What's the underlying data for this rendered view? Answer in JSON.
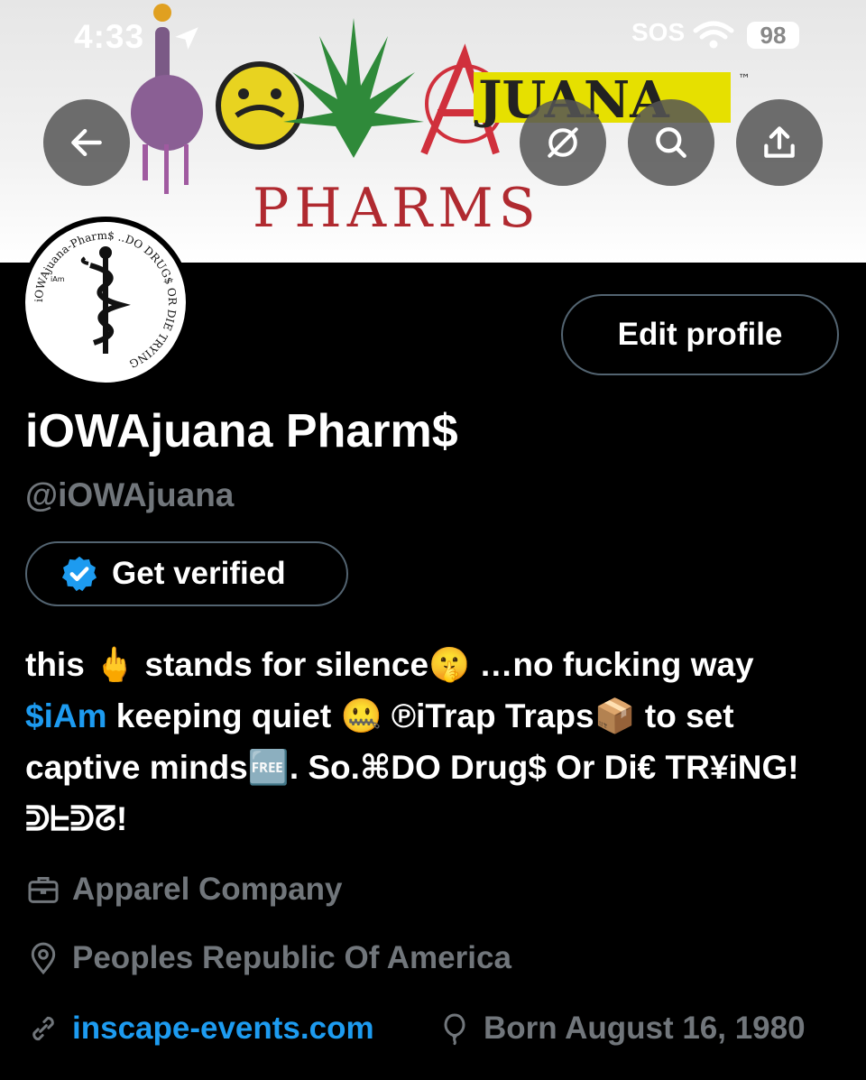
{
  "status_bar": {
    "time": "4:33",
    "carrier": "SOS",
    "battery": "98"
  },
  "banner": {
    "logo_text": "JUANA",
    "logo_tm": "™",
    "logo_subtitle": "PHARMS"
  },
  "avatar": {
    "ring_text": "iOWAjuana-Pharm$ ..DO DRUG$ OR DIE TRYING",
    "small_text": "iAm"
  },
  "header_buttons": {
    "back": "back-arrow",
    "grok": "slash-circle",
    "search": "search",
    "share": "share"
  },
  "profile": {
    "edit_label": "Edit profile",
    "display_name": "iOWAjuana Pharm$",
    "handle": "@iOWAjuana",
    "verified_label": "Get verified",
    "bio": {
      "part1": "this 🖕 stands for silence🤫 …no fucking way ",
      "mention": "$iAm",
      "part2": " keeping quiet 🤐 ℗iTrap Traps📦 to set captive minds🆓. So.⌘DO Drug$ Or Di€ TR¥iNG! ᕲᖶᕲᘔ!"
    },
    "category": "Apparel Company",
    "location": "Peoples Republic Of America",
    "website": "inscape-events.com",
    "birthday": "Born August 16, 1980"
  },
  "colors": {
    "accent": "#1d9bf0",
    "muted": "#71767b",
    "border": "#536471"
  }
}
